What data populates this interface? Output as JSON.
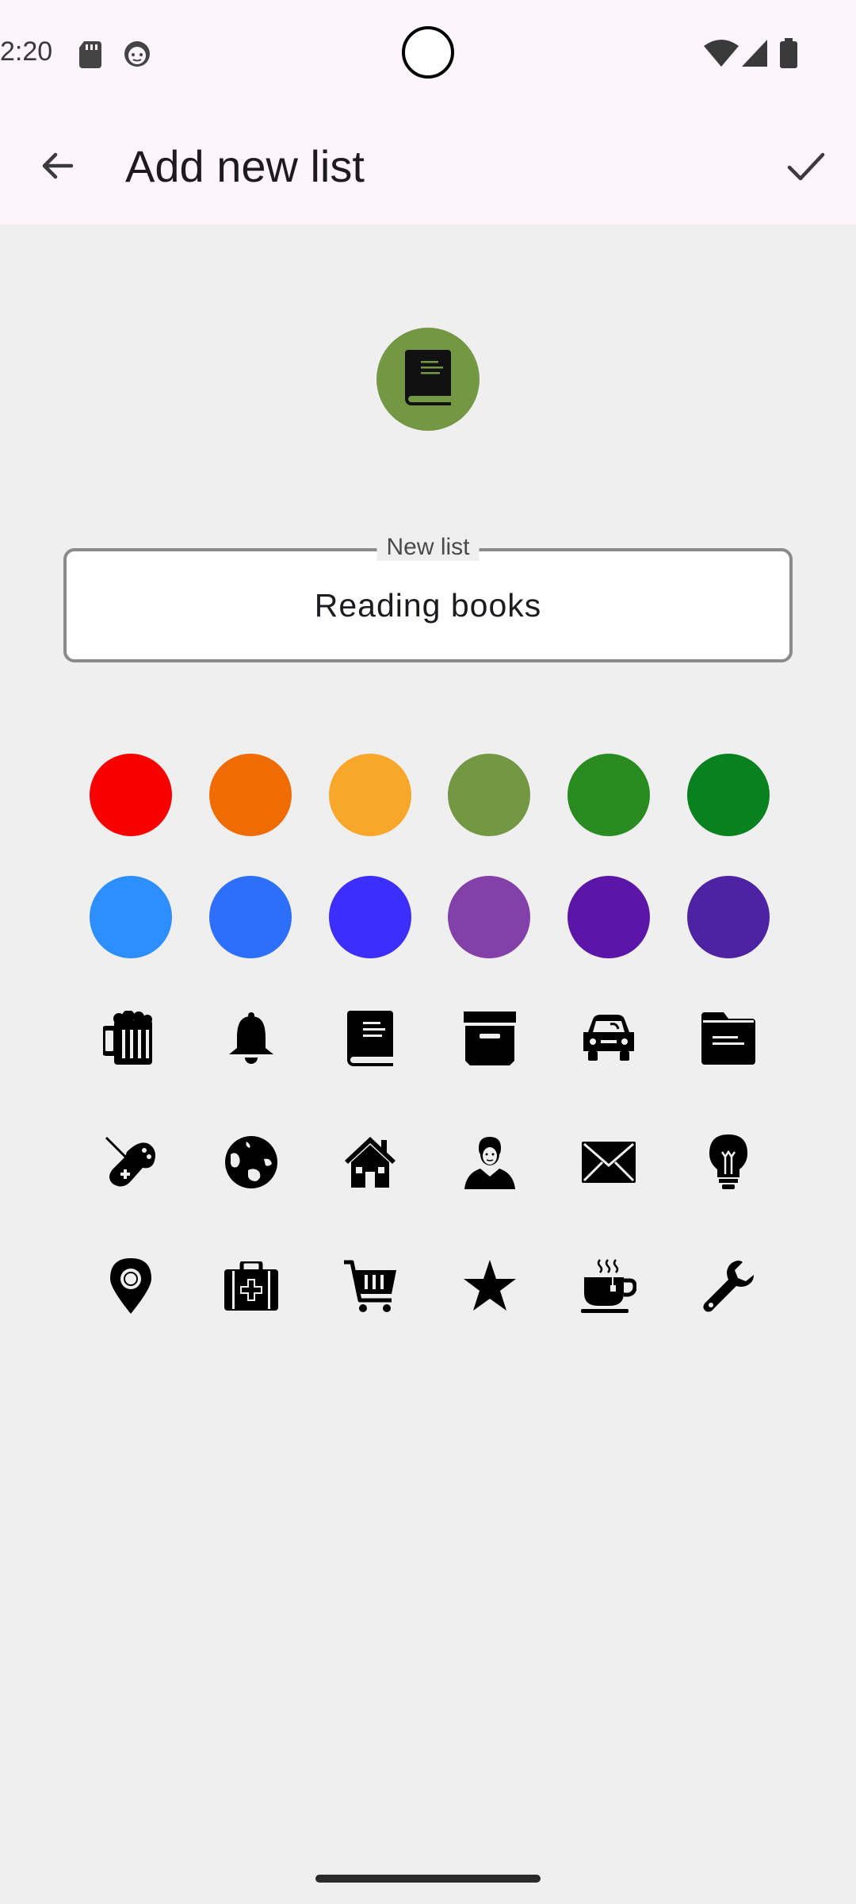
{
  "status_bar": {
    "time": "2:20",
    "left_icons": [
      "sd-card-icon",
      "face-icon"
    ],
    "right_icons": [
      "wifi-icon",
      "signal-icon",
      "battery-icon"
    ]
  },
  "app_bar": {
    "title": "Add new list",
    "back_icon": "arrow-back-icon",
    "confirm_icon": "check-icon"
  },
  "preview": {
    "icon": "book-icon",
    "color": "#749744"
  },
  "name_field": {
    "label": "New list",
    "value": "Reading books"
  },
  "colors": [
    "#f90000",
    "#ef6c02",
    "#f8a72a",
    "#749744",
    "#2a8b21",
    "#08811e",
    "#2d8ffd",
    "#2d6ffb",
    "#3c2efc",
    "#8240a8",
    "#5c16a7",
    "#4e23a3"
  ],
  "icons": [
    "beer-icon",
    "bell-icon",
    "book-icon",
    "archive-box-icon",
    "car-icon",
    "folder-icon",
    "gamepad-icon",
    "globe-icon",
    "house-icon",
    "person-icon",
    "envelope-icon",
    "lightbulb-icon",
    "location-pin-icon",
    "medical-kit-icon",
    "shopping-cart-icon",
    "star-icon",
    "coffee-cup-icon",
    "wrench-icon"
  ]
}
